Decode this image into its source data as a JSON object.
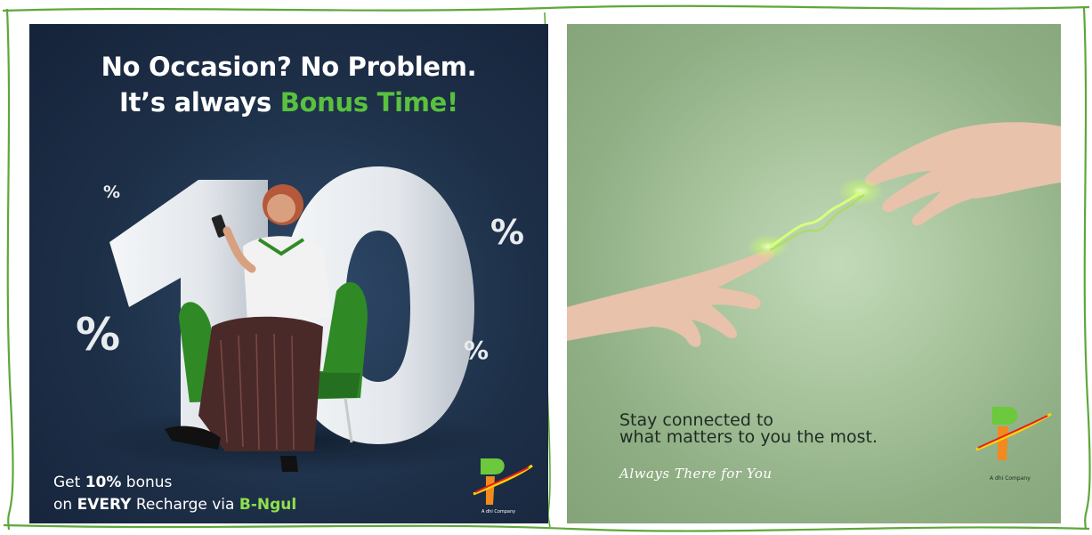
{
  "left_ad": {
    "headline_line1": "No Occasion? No Problem.",
    "headline_line2_prefix": "It’s always ",
    "headline_line2_highlight": "Bonus Time!",
    "big_number": "10",
    "percent_symbol": "%",
    "offer_line1_prefix": "Get ",
    "offer_line1_bold": "10%",
    "offer_line1_suffix": " bonus",
    "offer_line2_prefix": "on ",
    "offer_line2_bold": "EVERY",
    "offer_line2_middle": " Recharge via ",
    "offer_line2_brand": "B-Ngul",
    "logo_subtext": "A dhi Company",
    "colors": {
      "background": "#1d2f47",
      "accent_green": "#59c13f",
      "brand_green": "#8fe04c"
    }
  },
  "right_ad": {
    "tagline_line1": "Stay connected to",
    "tagline_line2": "what matters to you the most.",
    "slogan": "Always There for You",
    "logo_subtext": "A dhi Company",
    "colors": {
      "background": "#a9c59e",
      "spark_green": "#c9ff6a"
    }
  }
}
